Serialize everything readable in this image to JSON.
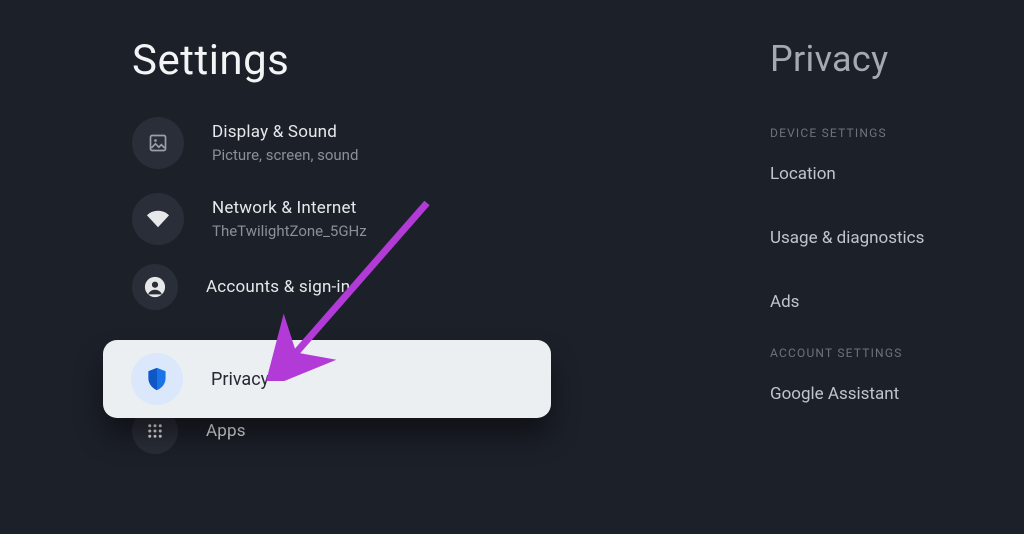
{
  "left": {
    "title": "Settings",
    "items": [
      {
        "id": "display",
        "label": "Display & Sound",
        "sub": "Picture, screen, sound",
        "icon": "image-icon"
      },
      {
        "id": "network",
        "label": "Network & Internet",
        "sub": "TheTwilightZone_5GHz",
        "icon": "wifi-icon"
      },
      {
        "id": "accounts",
        "label": "Accounts & sign-in",
        "sub": "",
        "icon": "account-icon"
      },
      {
        "id": "privacy",
        "label": "Privacy",
        "sub": "",
        "icon": "shield-icon",
        "selected": true
      },
      {
        "id": "apps",
        "label": "Apps",
        "sub": "",
        "icon": "apps-icon"
      }
    ]
  },
  "right": {
    "title": "Privacy",
    "sections": [
      {
        "heading": "DEVICE SETTINGS",
        "items": [
          "Location",
          "Usage & diagnostics",
          "Ads"
        ]
      },
      {
        "heading": "ACCOUNT SETTINGS",
        "items": [
          "Google Assistant"
        ]
      }
    ]
  },
  "colors": {
    "accent_arrow": "#b23bd8",
    "selected_bg": "#eceff2",
    "selected_icon_bg": "#dbe8fb",
    "shield_blue": "#1a73e8"
  }
}
